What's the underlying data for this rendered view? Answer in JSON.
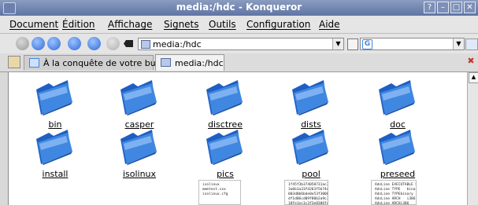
{
  "window": {
    "title": "media:/hdc - Konqueror",
    "controls": [
      "?",
      "–",
      "□",
      "✕"
    ]
  },
  "menu": {
    "items": [
      "Document",
      "Édition",
      "Affichage",
      "Signets",
      "Outils",
      "Configuration",
      "Aide"
    ]
  },
  "toolbar": {
    "buttons": [
      "back-icon",
      "forward-icon",
      "up-icon",
      "home-icon",
      "reload-icon",
      "stop-icon",
      "clear-location-icon"
    ],
    "location_value": "media:/hdc",
    "search_value": ""
  },
  "tabs": [
    {
      "label": "À la conquête de votre bure...",
      "active": false
    },
    {
      "label": "media:/hdc",
      "active": true
    }
  ],
  "folders": [
    {
      "label": "bin"
    },
    {
      "label": "casper"
    },
    {
      "label": "disctree"
    },
    {
      "label": "dists"
    },
    {
      "label": "doc"
    },
    {
      "label": "install"
    },
    {
      "label": "isolinux"
    },
    {
      "label": "pics"
    },
    {
      "label": "pool"
    },
    {
      "label": "preseed"
    }
  ],
  "files": [
    {
      "preview": "isolinux\nmemtest.cxx\nisolinux.cfg"
    },
    {
      "preview": "1f45f3b374058731ac300\n3a6b1a33fd263f5b74d4\n003d0b6bde0e53f30000\ndf1d06cd09f80b2a9c300\n10fe1ec1c3f3e8306fa6"
    },
    {
      "preview": "AdsLine EXECUTABLE Ub\nAdsLine TYPE   binary\nAdsLine TYPEbinary\nAdsLine ARCH   i386\nAdsLine ARCHi386   1"
    }
  ],
  "colors": {
    "titlebar": "#6f83b0",
    "folder": "#3f87e0"
  }
}
